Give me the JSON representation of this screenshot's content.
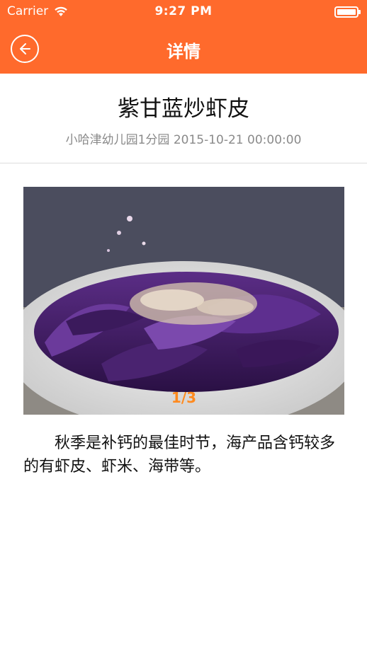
{
  "status_bar": {
    "carrier": "Carrier",
    "time": "9:27 PM",
    "wifi_icon": "wifi-icon",
    "battery_icon": "battery-icon"
  },
  "nav": {
    "title": "详情",
    "back_icon": "back-arrow-icon"
  },
  "article": {
    "title": "紫甘蓝炒虾皮",
    "meta": "小哈津幼儿园1分园 2015-10-21 00:00:00",
    "body": "秋季是补钙的最佳时节，海产品含钙较多的有虾皮、虾米、海带等。"
  },
  "gallery": {
    "counter": "1/3"
  },
  "colors": {
    "accent": "#FF6A2C",
    "counter": "#FF8A1F"
  }
}
